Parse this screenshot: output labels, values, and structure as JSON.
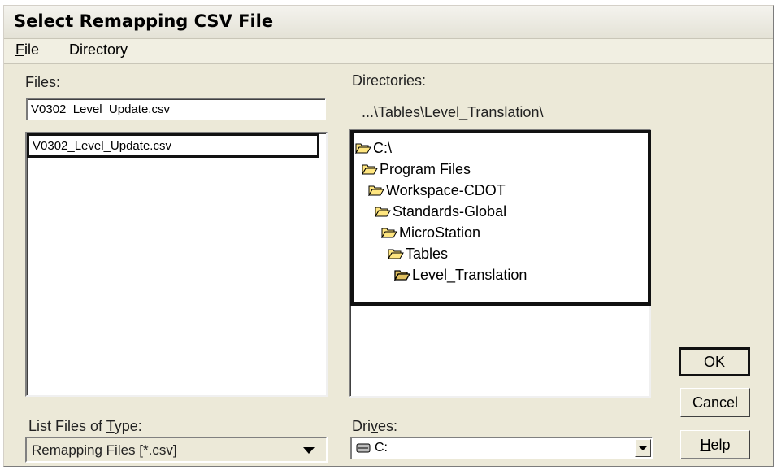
{
  "window": {
    "title": "Select Remapping CSV File"
  },
  "menu": {
    "file": "File",
    "file_hotkey": "F",
    "file_rest": "ile",
    "directory": "Directory"
  },
  "files": {
    "label": "Files:",
    "value": "V0302_Level_Update.csv",
    "items": [
      "V0302_Level_Update.csv"
    ]
  },
  "directories": {
    "label": "Directories:",
    "current_path": "...\\Tables\\Level_Translation\\",
    "tree": [
      {
        "label": "C:\\",
        "icon": "open-folder-icon"
      },
      {
        "label": "Program Files",
        "icon": "open-folder-icon"
      },
      {
        "label": "Workspace-CDOT",
        "icon": "open-folder-icon"
      },
      {
        "label": "Standards-Global",
        "icon": "open-folder-icon"
      },
      {
        "label": "MicroStation",
        "icon": "open-folder-icon"
      },
      {
        "label": "Tables",
        "icon": "open-folder-icon"
      },
      {
        "label": "Level_Translation",
        "icon": "open-folder-selected-icon"
      }
    ]
  },
  "file_type": {
    "label_pre": "List Files of ",
    "label_hot": "T",
    "label_post": "ype:",
    "selected": "Remapping Files [*.csv]"
  },
  "drives": {
    "label_pre": "Dri",
    "label_hot": "v",
    "label_post": "es:",
    "selected": "C:",
    "icon": "drive-icon"
  },
  "buttons": {
    "ok_hot": "O",
    "ok_rest": "K",
    "cancel": "Cancel",
    "help_hot": "H",
    "help_rest": "elp"
  },
  "colors": {
    "dialog_bg": "#ece9d8",
    "folder_yellow": "#ffe680",
    "folder_outline": "#000000"
  }
}
